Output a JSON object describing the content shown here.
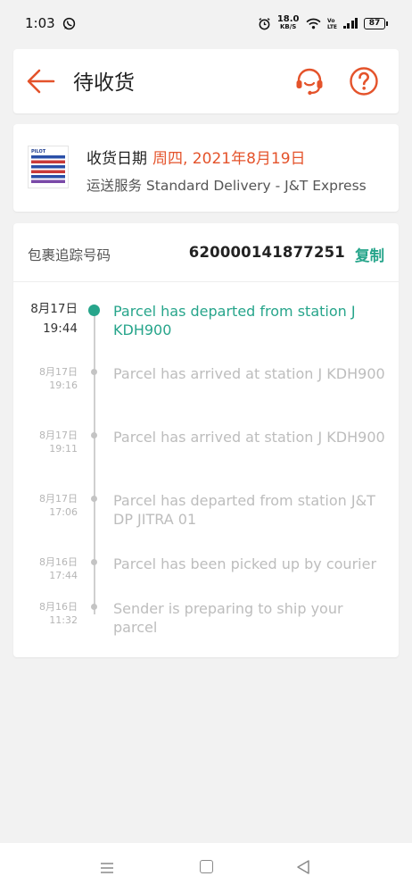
{
  "status_bar": {
    "time": "1:03",
    "speed_value": "18.0",
    "speed_unit": "KB/S",
    "battery": "87"
  },
  "header": {
    "title": "待收货",
    "accent_color": "#e4532b"
  },
  "delivery": {
    "date_label": "收货日期",
    "date_value": "周四, 2021年8月19日",
    "service": "运送服务 Standard Delivery  - J&T Express"
  },
  "tracking": {
    "label": "包裹追踪号码",
    "number": "620000141877251",
    "copy_label": "复制",
    "accent_color": "#27a58b",
    "events": [
      {
        "date": "8月17日",
        "time": "19:44",
        "text": "Parcel has departed from station J KDH900",
        "current": true
      },
      {
        "date": "8月17日",
        "time": "19:16",
        "text": "Parcel has arrived at station J KDH900",
        "current": false
      },
      {
        "date": "8月17日",
        "time": "19:11",
        "text": "Parcel has arrived at station J KDH900",
        "current": false
      },
      {
        "date": "8月17日",
        "time": "17:06",
        "text": "Parcel has departed from station J&T DP JITRA 01",
        "current": false
      },
      {
        "date": "8月16日",
        "time": "17:44",
        "text": "Parcel has been picked up by courier",
        "current": false
      },
      {
        "date": "8月16日",
        "time": "11:32",
        "text": "Sender is preparing to ship your parcel",
        "current": false
      }
    ]
  },
  "icons": {
    "back": "arrow-left-icon",
    "support": "headset-icon",
    "help": "question-circle-icon"
  }
}
